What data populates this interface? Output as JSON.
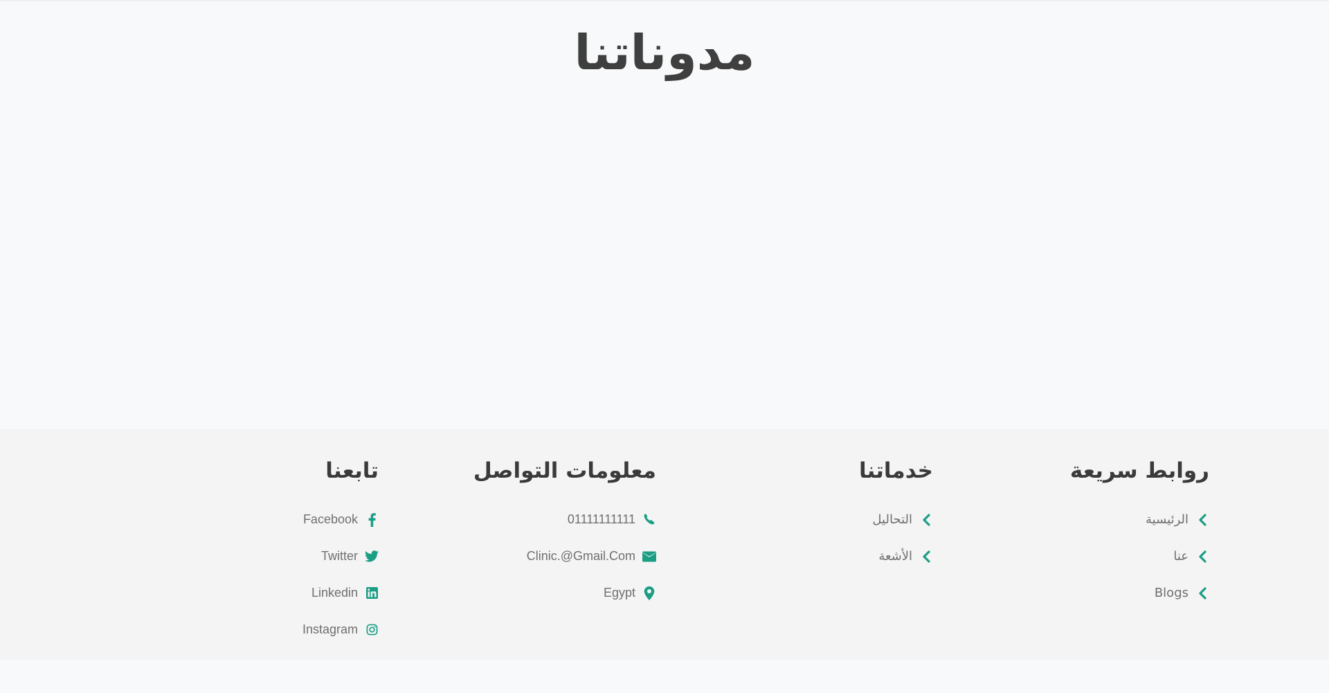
{
  "page": {
    "title": "مدوناتنا"
  },
  "footer": {
    "quick_links": {
      "title": "روابط سريعة",
      "items": [
        {
          "label": "الرئيسية",
          "icon": "chevron-left-icon"
        },
        {
          "label": "عنا",
          "icon": "chevron-left-icon"
        },
        {
          "label": "Blogs",
          "icon": "chevron-left-icon"
        }
      ]
    },
    "services": {
      "title": "خدماتنا",
      "items": [
        {
          "label": "التحاليل",
          "icon": "chevron-left-icon"
        },
        {
          "label": "الأشعة",
          "icon": "chevron-left-icon"
        }
      ]
    },
    "contact": {
      "title": "معلومات التواصل",
      "items": [
        {
          "label": "01111111111",
          "icon": "phone-icon"
        },
        {
          "label": "Clinic.@Gmail.Com",
          "icon": "envelope-icon"
        },
        {
          "label": "Egypt",
          "icon": "map-marker-icon"
        }
      ]
    },
    "follow": {
      "title": "تابعنا",
      "items": [
        {
          "label": "Facebook",
          "icon": "facebook-icon"
        },
        {
          "label": "Twitter",
          "icon": "twitter-icon"
        },
        {
          "label": "Linkedin",
          "icon": "linkedin-icon"
        },
        {
          "label": "Instagram",
          "icon": "instagram-icon"
        }
      ]
    }
  },
  "colors": {
    "accent": "#1b9e84",
    "heading": "#3a3a3a",
    "text": "#6f6f6f",
    "page_bg": "#f8f9fa",
    "footer_bg": "#f4f4f4"
  }
}
